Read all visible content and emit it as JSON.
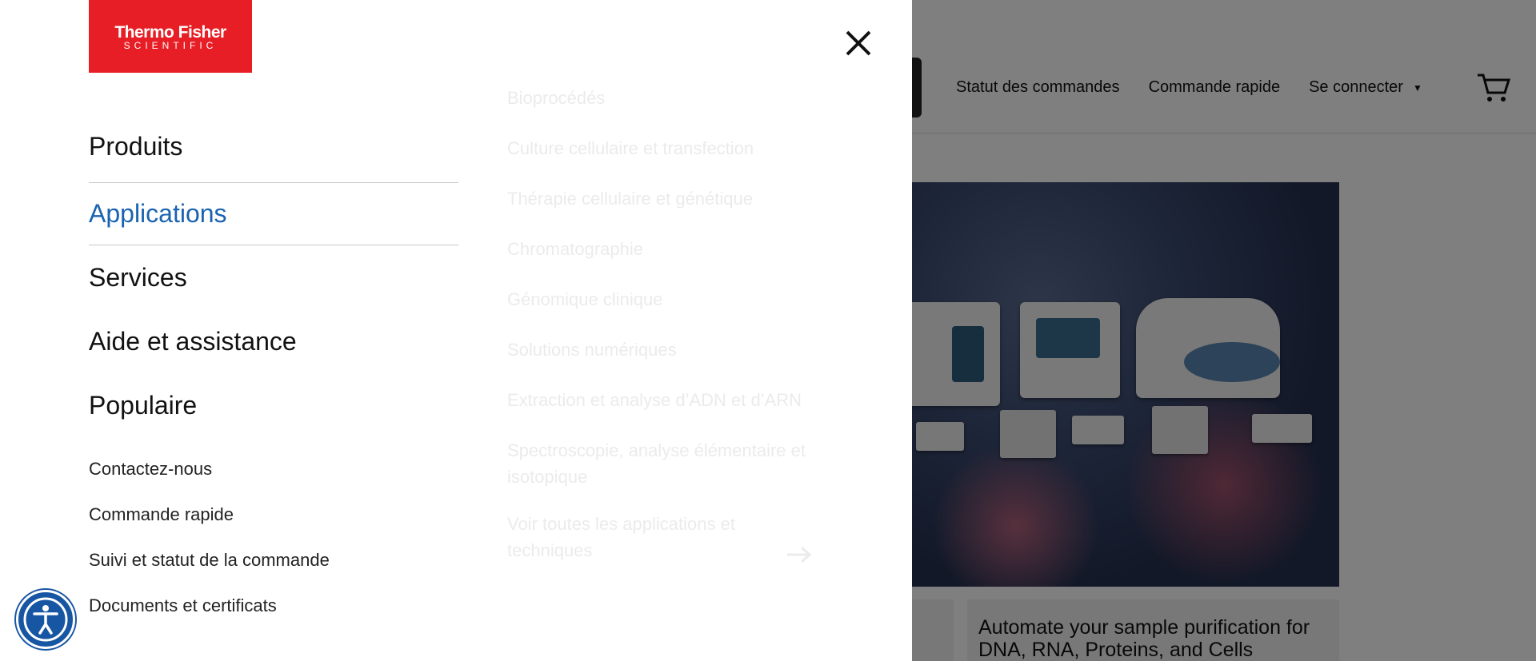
{
  "background": {
    "nav": {
      "order_status": "Statut des commandes",
      "quick_order": "Commande rapide",
      "sign_in": "Se connecter"
    },
    "card_text": "Automate your sample purification for DNA, RNA, Proteins, and Cells"
  },
  "menu": {
    "logo": {
      "line1": "Thermo Fisher",
      "line2": "SCIENTIFIC"
    },
    "main_nav": [
      {
        "label": "Produits",
        "active": false
      },
      {
        "label": "Applications",
        "active": true
      },
      {
        "label": "Services",
        "active": false
      },
      {
        "label": "Aide et assistance",
        "active": false
      },
      {
        "label": "Populaire",
        "active": false
      }
    ],
    "sub_links": [
      "Contactez-nous",
      "Commande rapide",
      "Suivi et statut de la commande",
      "Documents et certificats"
    ],
    "applications": [
      "Bioprocédés",
      "Culture cellulaire et transfection",
      "Thérapie cellulaire et génétique",
      "Chromatographie",
      "Génomique clinique",
      "Solutions numériques",
      "Extraction et analyse d’ADN et d’ARN",
      "Spectroscopie, analyse élémentaire et isotopique"
    ],
    "applications_all": "Voir toutes les applications et techniques"
  },
  "colors": {
    "brand_red": "#e71e25",
    "active_blue": "#1a63b0",
    "accessibility_blue": "#1756a3"
  },
  "icons": {
    "close": "close-icon",
    "cart": "cart-icon",
    "accessibility": "accessibility-icon",
    "arrow": "arrow-right-icon"
  }
}
